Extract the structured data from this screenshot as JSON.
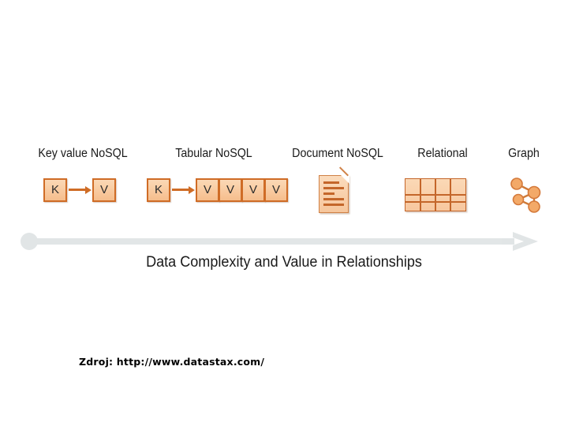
{
  "slide": {
    "background_color": "#ffffff",
    "accent_orange": "#cf6c26",
    "icon_fill": "#f8c9a0",
    "arrow_color": "#25788f"
  },
  "categories": [
    {
      "label": "Key value NoSQL",
      "icon": "key-value-icon"
    },
    {
      "label": "Tabular NoSQL",
      "icon": "tabular-icon"
    },
    {
      "label": "Document NoSQL",
      "icon": "document-icon"
    },
    {
      "label": "Relational",
      "icon": "table-grid-icon"
    },
    {
      "label": "Graph",
      "icon": "graph-nodes-icon"
    }
  ],
  "key_value": {
    "key_label": "K",
    "value_label": "V"
  },
  "tabular": {
    "key_label": "K",
    "value_labels": [
      "V",
      "V",
      "V",
      "V"
    ]
  },
  "arrow": {
    "caption": "Data Complexity and Value in Relationships",
    "direction": "right",
    "color": "#25788f"
  },
  "source": {
    "text": "Zdroj: http://www.datastax.com/"
  }
}
